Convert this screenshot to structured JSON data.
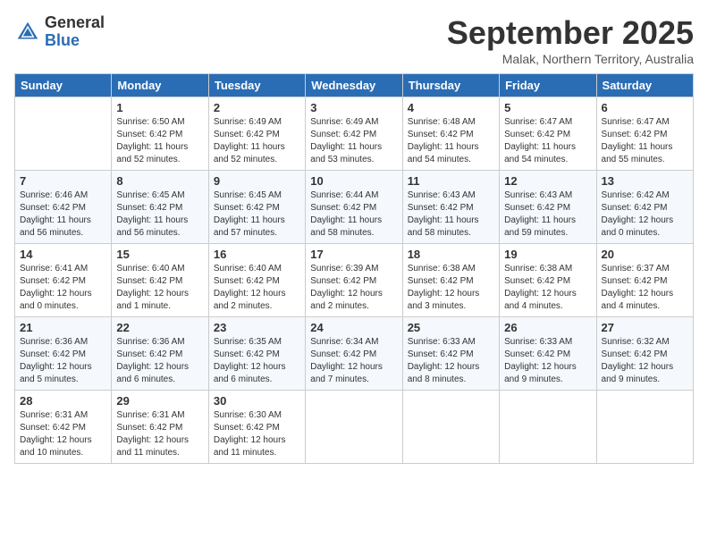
{
  "header": {
    "logo_general": "General",
    "logo_blue": "Blue",
    "month": "September 2025",
    "location": "Malak, Northern Territory, Australia"
  },
  "days_of_week": [
    "Sunday",
    "Monday",
    "Tuesday",
    "Wednesday",
    "Thursday",
    "Friday",
    "Saturday"
  ],
  "weeks": [
    [
      {
        "day": "",
        "info": ""
      },
      {
        "day": "1",
        "info": "Sunrise: 6:50 AM\nSunset: 6:42 PM\nDaylight: 11 hours\nand 52 minutes."
      },
      {
        "day": "2",
        "info": "Sunrise: 6:49 AM\nSunset: 6:42 PM\nDaylight: 11 hours\nand 52 minutes."
      },
      {
        "day": "3",
        "info": "Sunrise: 6:49 AM\nSunset: 6:42 PM\nDaylight: 11 hours\nand 53 minutes."
      },
      {
        "day": "4",
        "info": "Sunrise: 6:48 AM\nSunset: 6:42 PM\nDaylight: 11 hours\nand 54 minutes."
      },
      {
        "day": "5",
        "info": "Sunrise: 6:47 AM\nSunset: 6:42 PM\nDaylight: 11 hours\nand 54 minutes."
      },
      {
        "day": "6",
        "info": "Sunrise: 6:47 AM\nSunset: 6:42 PM\nDaylight: 11 hours\nand 55 minutes."
      }
    ],
    [
      {
        "day": "7",
        "info": "Sunrise: 6:46 AM\nSunset: 6:42 PM\nDaylight: 11 hours\nand 56 minutes."
      },
      {
        "day": "8",
        "info": "Sunrise: 6:45 AM\nSunset: 6:42 PM\nDaylight: 11 hours\nand 56 minutes."
      },
      {
        "day": "9",
        "info": "Sunrise: 6:45 AM\nSunset: 6:42 PM\nDaylight: 11 hours\nand 57 minutes."
      },
      {
        "day": "10",
        "info": "Sunrise: 6:44 AM\nSunset: 6:42 PM\nDaylight: 11 hours\nand 58 minutes."
      },
      {
        "day": "11",
        "info": "Sunrise: 6:43 AM\nSunset: 6:42 PM\nDaylight: 11 hours\nand 58 minutes."
      },
      {
        "day": "12",
        "info": "Sunrise: 6:43 AM\nSunset: 6:42 PM\nDaylight: 11 hours\nand 59 minutes."
      },
      {
        "day": "13",
        "info": "Sunrise: 6:42 AM\nSunset: 6:42 PM\nDaylight: 12 hours\nand 0 minutes."
      }
    ],
    [
      {
        "day": "14",
        "info": "Sunrise: 6:41 AM\nSunset: 6:42 PM\nDaylight: 12 hours\nand 0 minutes."
      },
      {
        "day": "15",
        "info": "Sunrise: 6:40 AM\nSunset: 6:42 PM\nDaylight: 12 hours\nand 1 minute."
      },
      {
        "day": "16",
        "info": "Sunrise: 6:40 AM\nSunset: 6:42 PM\nDaylight: 12 hours\nand 2 minutes."
      },
      {
        "day": "17",
        "info": "Sunrise: 6:39 AM\nSunset: 6:42 PM\nDaylight: 12 hours\nand 2 minutes."
      },
      {
        "day": "18",
        "info": "Sunrise: 6:38 AM\nSunset: 6:42 PM\nDaylight: 12 hours\nand 3 minutes."
      },
      {
        "day": "19",
        "info": "Sunrise: 6:38 AM\nSunset: 6:42 PM\nDaylight: 12 hours\nand 4 minutes."
      },
      {
        "day": "20",
        "info": "Sunrise: 6:37 AM\nSunset: 6:42 PM\nDaylight: 12 hours\nand 4 minutes."
      }
    ],
    [
      {
        "day": "21",
        "info": "Sunrise: 6:36 AM\nSunset: 6:42 PM\nDaylight: 12 hours\nand 5 minutes."
      },
      {
        "day": "22",
        "info": "Sunrise: 6:36 AM\nSunset: 6:42 PM\nDaylight: 12 hours\nand 6 minutes."
      },
      {
        "day": "23",
        "info": "Sunrise: 6:35 AM\nSunset: 6:42 PM\nDaylight: 12 hours\nand 6 minutes."
      },
      {
        "day": "24",
        "info": "Sunrise: 6:34 AM\nSunset: 6:42 PM\nDaylight: 12 hours\nand 7 minutes."
      },
      {
        "day": "25",
        "info": "Sunrise: 6:33 AM\nSunset: 6:42 PM\nDaylight: 12 hours\nand 8 minutes."
      },
      {
        "day": "26",
        "info": "Sunrise: 6:33 AM\nSunset: 6:42 PM\nDaylight: 12 hours\nand 9 minutes."
      },
      {
        "day": "27",
        "info": "Sunrise: 6:32 AM\nSunset: 6:42 PM\nDaylight: 12 hours\nand 9 minutes."
      }
    ],
    [
      {
        "day": "28",
        "info": "Sunrise: 6:31 AM\nSunset: 6:42 PM\nDaylight: 12 hours\nand 10 minutes."
      },
      {
        "day": "29",
        "info": "Sunrise: 6:31 AM\nSunset: 6:42 PM\nDaylight: 12 hours\nand 11 minutes."
      },
      {
        "day": "30",
        "info": "Sunrise: 6:30 AM\nSunset: 6:42 PM\nDaylight: 12 hours\nand 11 minutes."
      },
      {
        "day": "",
        "info": ""
      },
      {
        "day": "",
        "info": ""
      },
      {
        "day": "",
        "info": ""
      },
      {
        "day": "",
        "info": ""
      }
    ]
  ]
}
